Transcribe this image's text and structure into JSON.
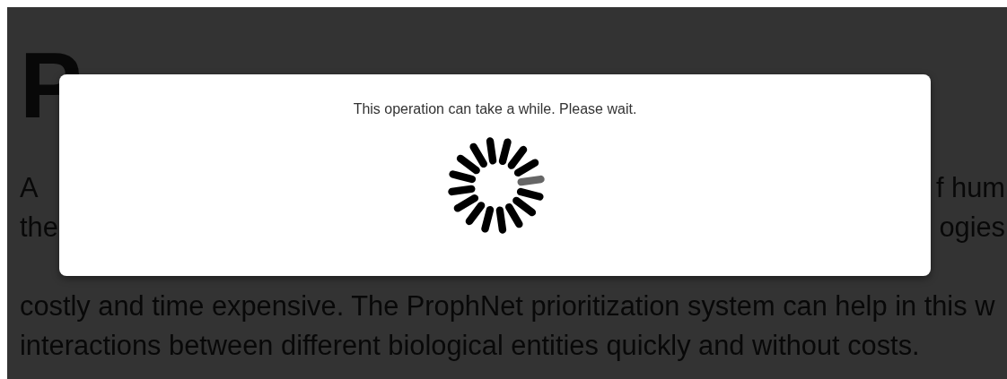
{
  "page": {
    "title": "P",
    "upper_lines": [
      {
        "left": "A",
        "right": "f hum"
      },
      {
        "left": "the",
        "right": "ogies"
      }
    ],
    "lower_lines": [
      {
        "left": "costly and time expensive. The ProphNet prioritization system can help in this w"
      },
      {
        "left": "interactions between different biological entities quickly and without costs."
      }
    ]
  },
  "dialog": {
    "message": "This operation can take a while. Please wait."
  }
}
